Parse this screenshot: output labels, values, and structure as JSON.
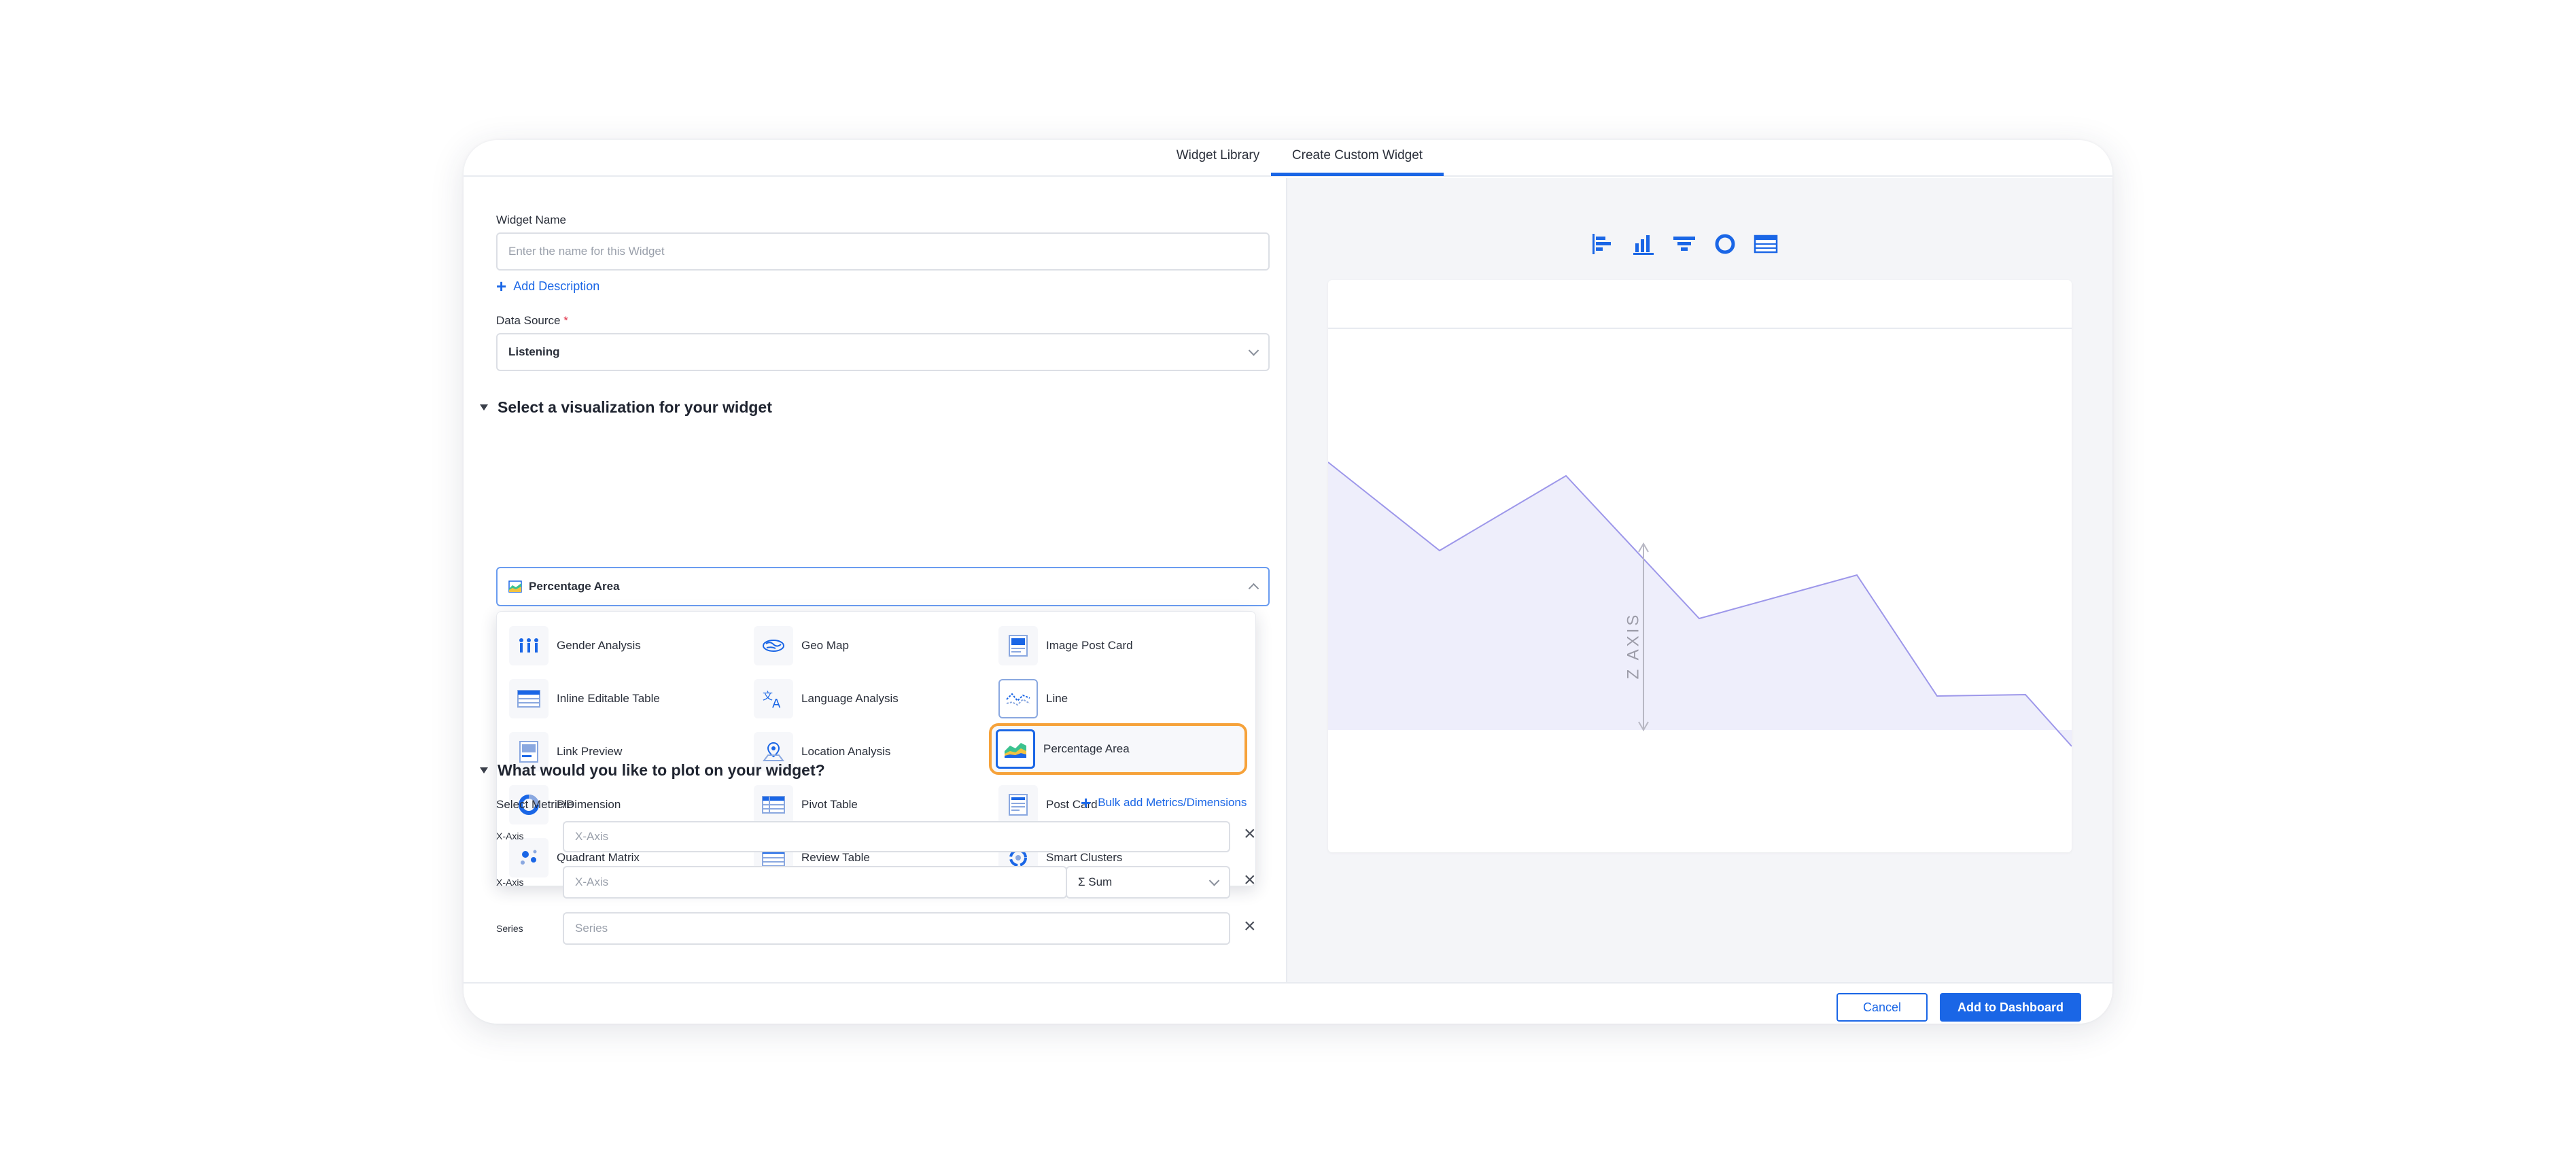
{
  "tabs": [
    {
      "label": "Widget Library"
    },
    {
      "label": "Create Custom Widget",
      "active": true
    }
  ],
  "form": {
    "widget_name_label": "Widget Name",
    "widget_name_placeholder": "Enter the name for this Widget",
    "add_description": "Add Description",
    "data_source_label": "Data Source",
    "data_source_required": "*",
    "data_source_value": "Listening"
  },
  "visualization": {
    "section_title": "Select a visualization for your widget",
    "selected": "Percentage Area",
    "options": [
      {
        "label": "Gender Analysis",
        "icon": "gender-analysis-icon"
      },
      {
        "label": "Geo Map",
        "icon": "geo-map-icon"
      },
      {
        "label": "Image Post Card",
        "icon": "image-post-card-icon"
      },
      {
        "label": "Inline Editable Table",
        "icon": "table-icon"
      },
      {
        "label": "Language Analysis",
        "icon": "language-icon"
      },
      {
        "label": "Line",
        "icon": "line-chart-icon"
      },
      {
        "label": "Link Preview",
        "icon": "link-preview-icon"
      },
      {
        "label": "Location Analysis",
        "icon": "location-icon"
      },
      {
        "label": "Percentage Area",
        "icon": "percentage-area-icon",
        "selected": true
      },
      {
        "label": "Pie",
        "icon": "pie-icon"
      },
      {
        "label": "Pivot Table",
        "icon": "pivot-table-icon"
      },
      {
        "label": "Post Card",
        "icon": "post-card-icon"
      },
      {
        "label": "Quadrant Matrix",
        "icon": "quadrant-matrix-icon"
      },
      {
        "label": "Review Table",
        "icon": "review-table-icon"
      },
      {
        "label": "Smart Clusters",
        "icon": "smart-clusters-icon"
      }
    ]
  },
  "plot": {
    "section_title": "What would you like to plot on your widget?",
    "metric_label": "Select Metric/Dimension",
    "bulk_add": "Bulk add Metrics/Dimensions",
    "rows": [
      {
        "label": "X-Axis",
        "placeholder": "X-Axis"
      },
      {
        "label": "X-Axis",
        "placeholder": "X-Axis",
        "aggregation": "Σ Sum"
      },
      {
        "label": "Series",
        "placeholder": "Series"
      }
    ]
  },
  "preview": {
    "axis_label": "Z AXIS",
    "chart_type_icons": [
      "horizontal-bar-icon",
      "column-chart-icon",
      "funnel-icon",
      "donut-icon",
      "table-icon"
    ]
  },
  "footer": {
    "cancel": "Cancel",
    "add": "Add to Dashboard"
  },
  "colors": {
    "accent": "#1a66e6",
    "highlight": "#f6a23a",
    "area_fill": "#eeeefb",
    "area_line": "#9d97ea"
  }
}
